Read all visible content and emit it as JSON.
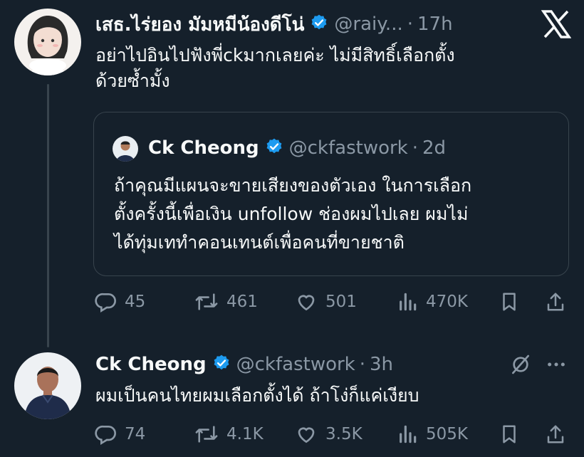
{
  "tweet1": {
    "name": "เสธ.ไร่ยอง มัมหมีน้องดีโน่",
    "handle": "@raiy...",
    "time": "17h",
    "text_line1": "อย่าไปอินไปฟังพี่ckมากเลยค่ะ ไม่มีสิทธิ์เลือกตั้ง",
    "text_line2": "ด้วยซ้ำมั้ง",
    "actions": {
      "replies": "45",
      "reposts": "461",
      "likes": "501",
      "views": "470K"
    }
  },
  "quote": {
    "name": "Ck Cheong",
    "handle": "@ckfastwork",
    "time": "2d",
    "text_line1": "ถ้าคุณมีแผนจะขายเสียงของตัวเอง ในการเลือก",
    "text_line2": "ตั้งครั้งนี้เพื่อเงิน unfollow ช่องผมไปเลย ผมไม่",
    "text_line3": "ได้ทุ่มเททำคอนเทนต์เพื่อคนที่ขายชาติ"
  },
  "tweet2": {
    "name": "Ck Cheong",
    "handle": "@ckfastwork",
    "time": "3h",
    "text_line1": "ผมเป็นคนไทยผมเลือกตั้งได้ ถ้าโง่ก็แค่เงียบ",
    "actions": {
      "replies": "74",
      "reposts": "4.1K",
      "likes": "3.5K",
      "views": "505K"
    }
  },
  "separator": "·",
  "icons": [
    "x-logo-icon",
    "verified-badge-icon",
    "reply-icon",
    "repost-icon",
    "like-icon",
    "views-icon",
    "bookmark-icon",
    "share-icon",
    "grok-icon",
    "more-icon"
  ],
  "colors": {
    "background": "#15202b",
    "text": "#f7f9f9",
    "muted": "#8b98a5",
    "verified": "#1d9bf0",
    "border": "#38444d"
  }
}
